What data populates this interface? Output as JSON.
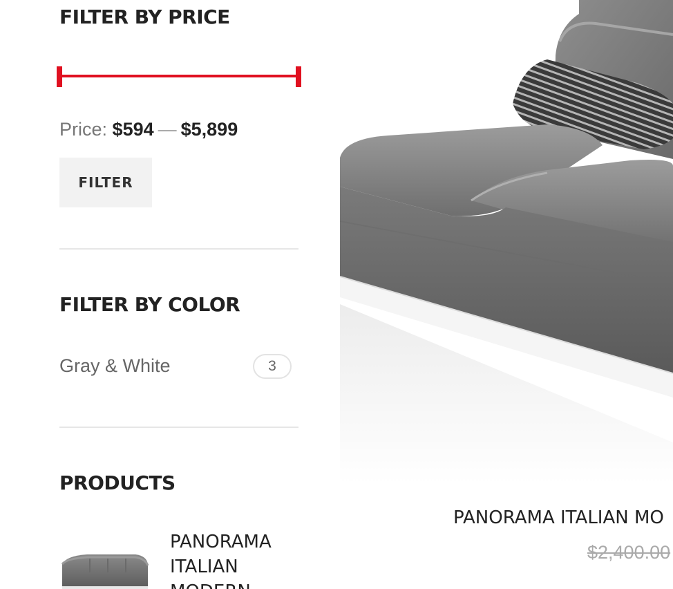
{
  "sidebar": {
    "price_filter": {
      "title": "FILTER BY PRICE",
      "price_prefix": "Price:",
      "min_price": "$594",
      "separator": "—",
      "max_price": "$5,899",
      "button_label": "FILTER",
      "accent_color": "#e01020"
    },
    "color_filter": {
      "title": "FILTER BY COLOR",
      "options": [
        {
          "label": "Gray & White",
          "count": "3"
        }
      ]
    },
    "products_widget": {
      "title": "PRODUCTS",
      "items": [
        {
          "name": "PANORAMA ITALIAN MODERN",
          "thumb_icon": "sofa-thumbnail"
        }
      ]
    }
  },
  "main": {
    "product": {
      "image_icon": "gray-sofa-image",
      "title": "PANORAMA ITALIAN MO",
      "old_price": "$2,400.00"
    }
  }
}
